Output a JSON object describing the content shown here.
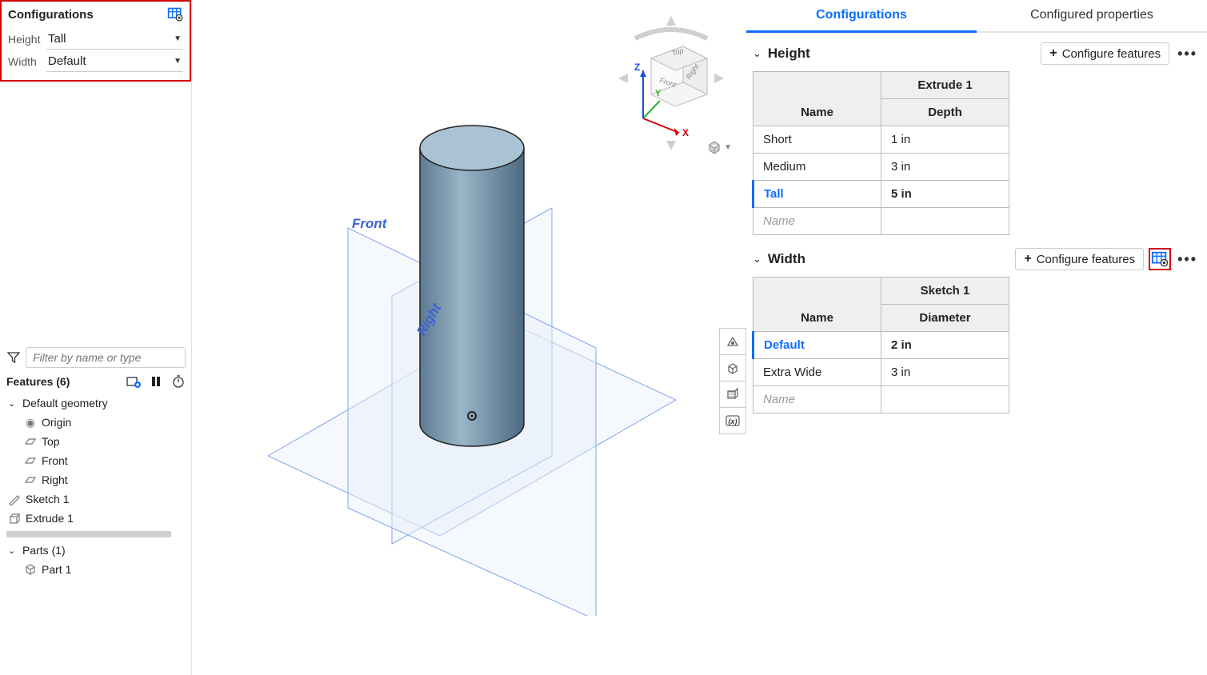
{
  "left_panel": {
    "configurations_title": "Configurations",
    "height_label": "Height",
    "height_value": "Tall",
    "width_label": "Width",
    "width_value": "Default",
    "filter_placeholder": "Filter by name or type",
    "features_title": "Features (6)",
    "default_geometry": "Default geometry",
    "origin": "Origin",
    "top": "Top",
    "front": "Front",
    "right": "Right",
    "sketch1": "Sketch 1",
    "extrude1": "Extrude 1",
    "parts_title": "Parts (1)",
    "part1": "Part 1"
  },
  "viewport": {
    "front_label": "Front",
    "right_label": "Right",
    "axis_x": "X",
    "axis_y": "Y",
    "axis_z": "Z",
    "cube_top": "Top",
    "cube_front": "Front",
    "cube_right": "Right"
  },
  "right_panel": {
    "tab_configurations": "Configurations",
    "tab_configured_properties": "Configured properties",
    "height_section": "Height",
    "width_section": "Width",
    "configure_features": "Configure features",
    "height_table": {
      "col_name": "Name",
      "col_group": "Extrude 1",
      "col_sub": "Depth",
      "rows": [
        {
          "name": "Short",
          "value": "1 in"
        },
        {
          "name": "Medium",
          "value": "3 in"
        },
        {
          "name": "Tall",
          "value": "5 in"
        }
      ],
      "placeholder": "Name"
    },
    "width_table": {
      "col_name": "Name",
      "col_group": "Sketch 1",
      "col_sub": "Diameter",
      "rows": [
        {
          "name": "Default",
          "value": "2 in"
        },
        {
          "name": "Extra Wide",
          "value": "3 in"
        }
      ],
      "placeholder": "Name"
    }
  }
}
